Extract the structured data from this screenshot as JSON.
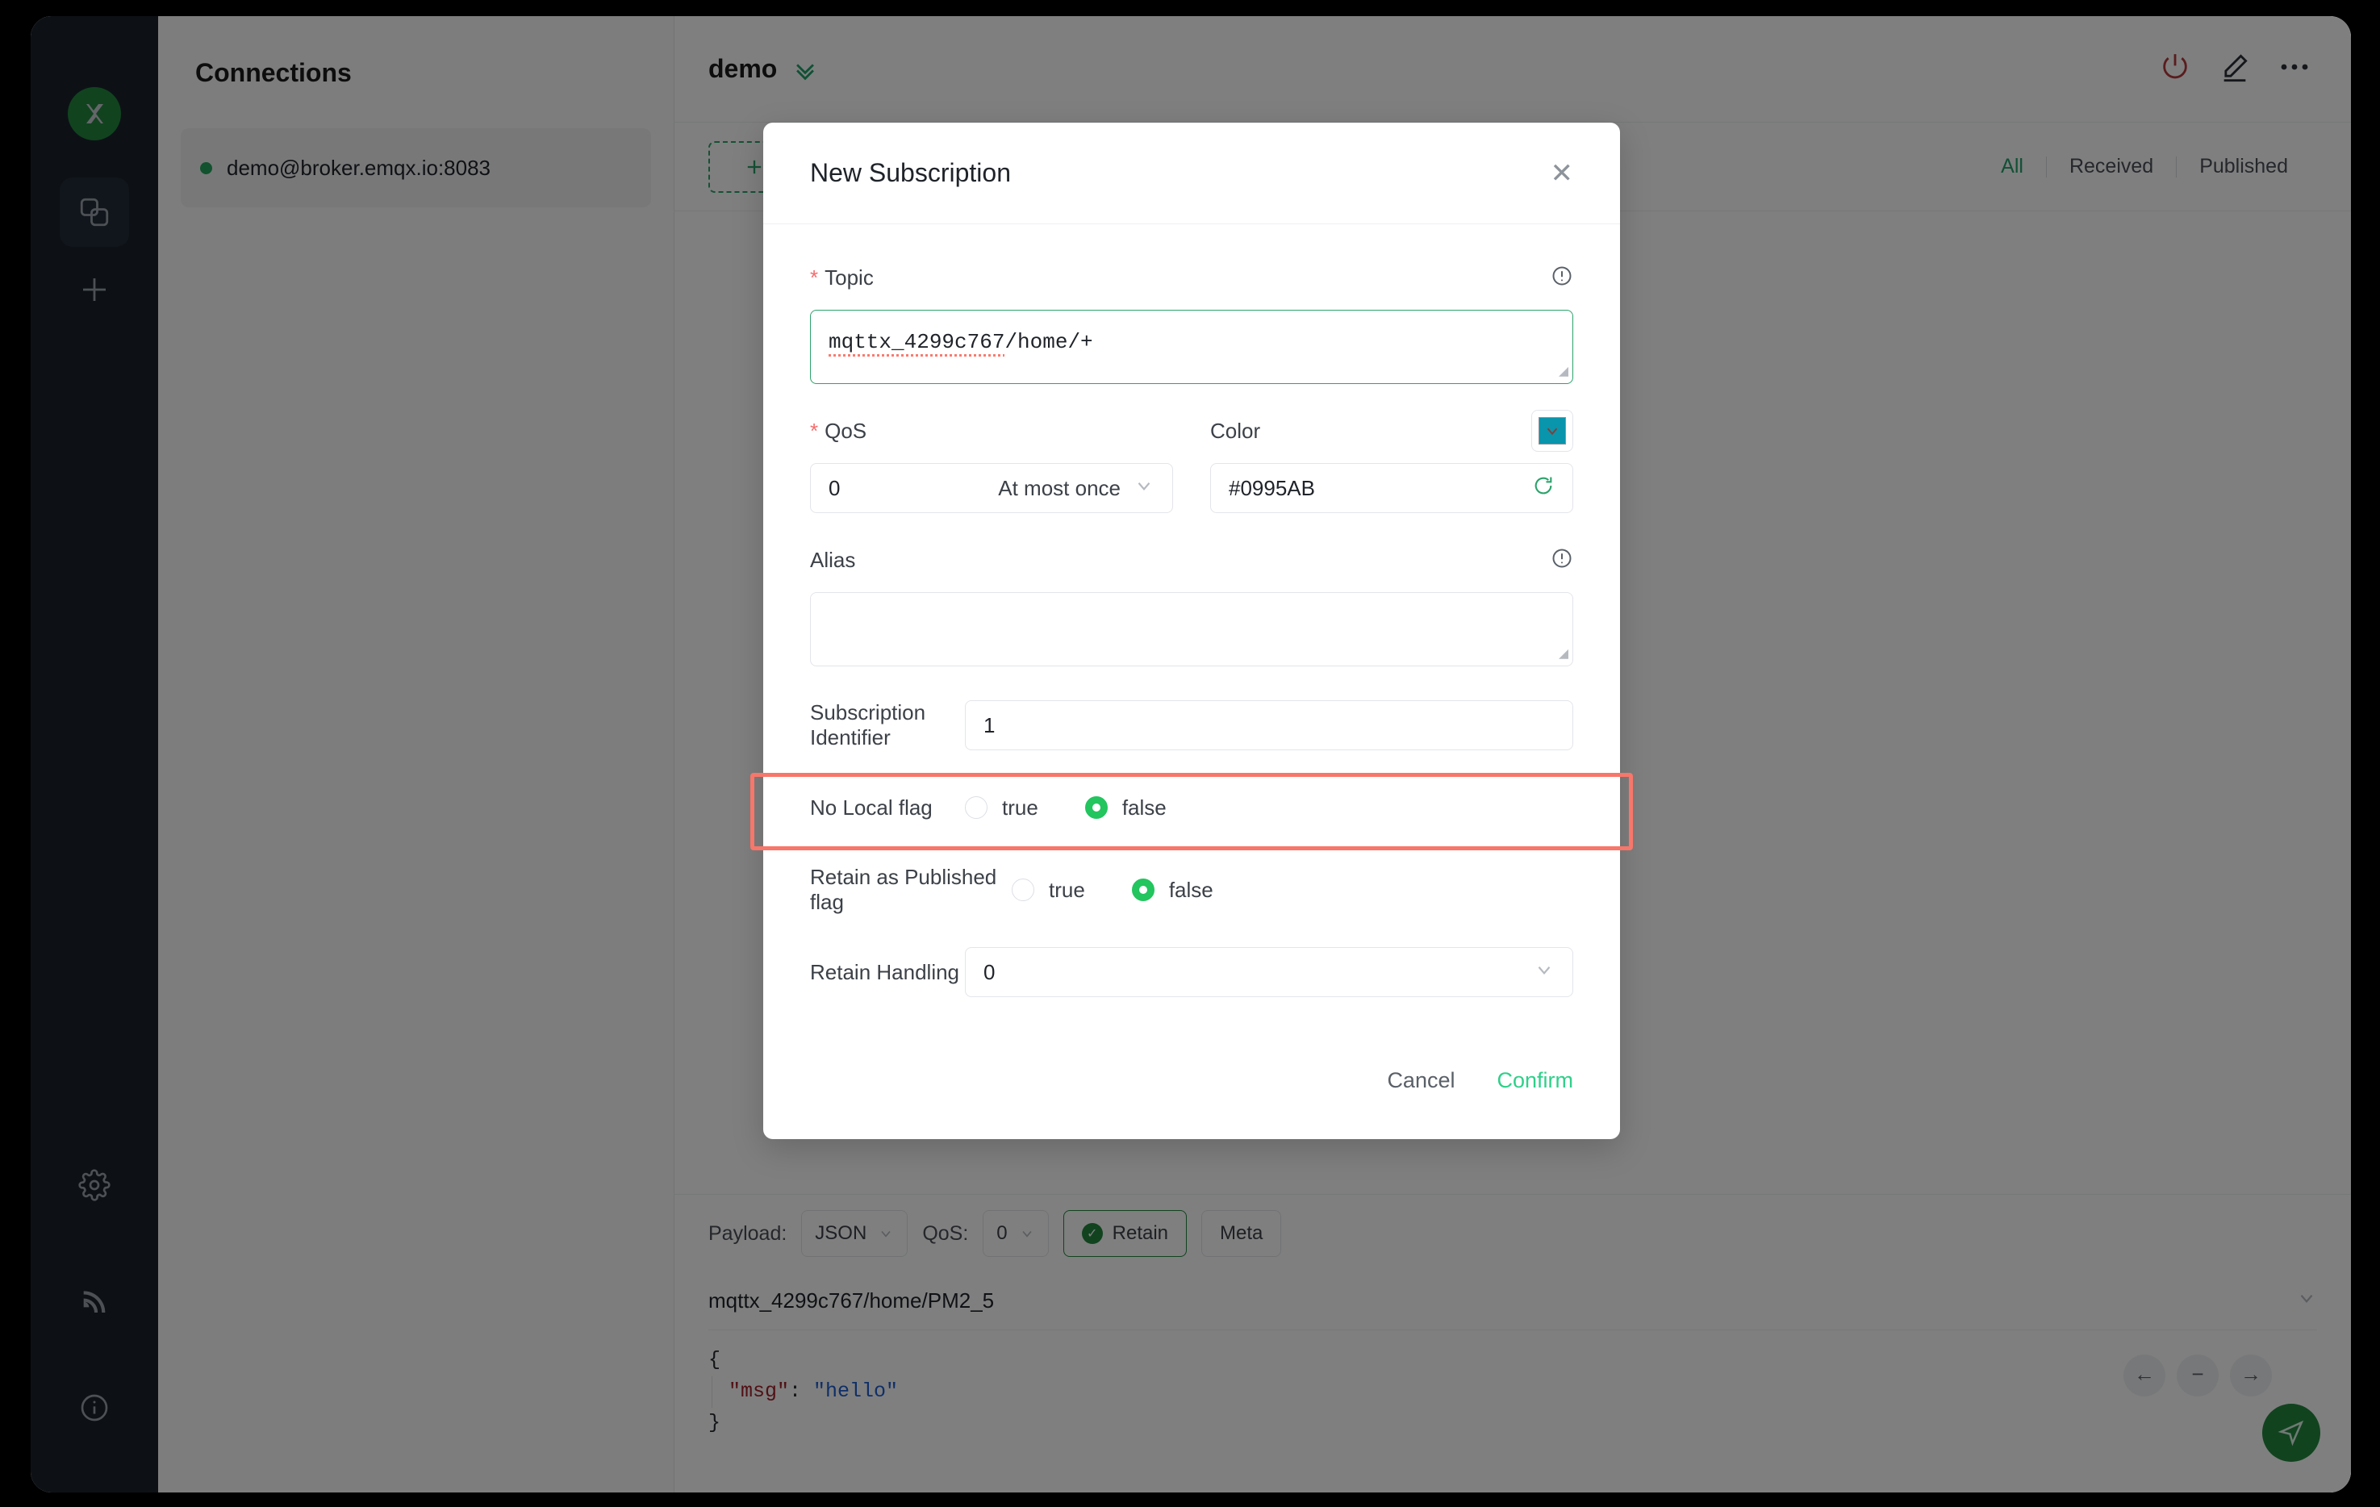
{
  "sidebar": {
    "logo_name": "emqx-logo",
    "items": [
      {
        "name": "connections-icon",
        "label": "Connections"
      },
      {
        "name": "add-icon",
        "label": "New Connection"
      },
      {
        "name": "gear-icon",
        "label": "Settings"
      },
      {
        "name": "broadcast-icon",
        "label": "Log"
      },
      {
        "name": "info-icon",
        "label": "About"
      }
    ]
  },
  "connections": {
    "title": "Connections",
    "items": [
      {
        "label": "demo@broker.emqx.io:8083",
        "status": "connected",
        "status_color": "#25a55d"
      }
    ]
  },
  "main": {
    "title": "demo",
    "header_actions": [
      {
        "name": "power-icon",
        "label": "Disconnect",
        "color": "#b4393b"
      },
      {
        "name": "edit-icon",
        "label": "Edit"
      },
      {
        "name": "more-icon",
        "label": "More"
      }
    ],
    "new_subscription_button": "New Subscription",
    "message_filters": [
      {
        "label": "All",
        "active": true
      },
      {
        "label": "Received",
        "active": false
      },
      {
        "label": "Published",
        "active": false
      }
    ]
  },
  "publish": {
    "payload_label": "Payload:",
    "payload_format": "JSON",
    "qos_label": "QoS:",
    "qos_value": "0",
    "retain_label": "Retain",
    "retain_on": true,
    "meta_label": "Meta",
    "topic": "mqttx_4299c767/home/PM2_5",
    "payload_lines": {
      "open": "{",
      "key": "\"msg\"",
      "colon": ": ",
      "value": "\"hello\"",
      "close": "}"
    },
    "nav_buttons": [
      {
        "name": "prev-icon",
        "glyph": "←"
      },
      {
        "name": "minus-icon",
        "glyph": "−"
      },
      {
        "name": "next-icon",
        "glyph": "→"
      }
    ],
    "send_button_label": "Send"
  },
  "modal": {
    "title": "New Subscription",
    "close_label": "✕",
    "topic": {
      "label": "Topic",
      "required": true,
      "value": "mqttx_4299c767/home/+",
      "spellcheck_part": "mqttx_4299c767",
      "rest_part": "/home/+"
    },
    "qos": {
      "label": "QoS",
      "required": true,
      "value": "0",
      "value_text": "At most once"
    },
    "color": {
      "label": "Color",
      "value": "#0995AB",
      "swatch": "#0995AB"
    },
    "alias": {
      "label": "Alias",
      "value": ""
    },
    "subscription_identifier": {
      "label": "Subscription Identifier",
      "value": "1",
      "highlight_color": "#f8766a"
    },
    "no_local_flag": {
      "label": "No Local flag",
      "options": [
        "true",
        "false"
      ],
      "selected": "false"
    },
    "retain_as_published_flag": {
      "label": "Retain as Published flag",
      "options": [
        "true",
        "false"
      ],
      "selected": "false"
    },
    "retain_handling": {
      "label": "Retain Handling",
      "value": "0"
    },
    "cancel_label": "Cancel",
    "confirm_label": "Confirm"
  }
}
